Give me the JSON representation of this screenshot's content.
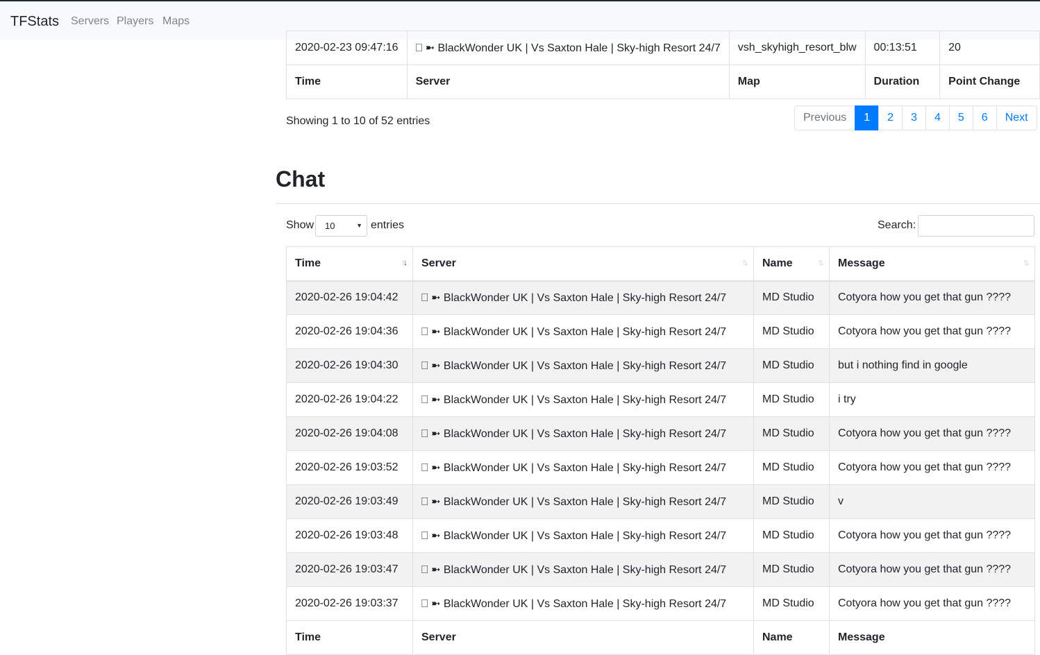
{
  "nav": {
    "brand": "TFStats",
    "links": [
      "Servers",
      "Players",
      "Maps"
    ]
  },
  "history": {
    "last_row": {
      "time": "2020-02-23 09:47:16",
      "server": "⎕ ➼ BlackWonder UK | Vs Saxton Hale | Sky-high Resort 24/7",
      "map": "vsh_skyhigh_resort_blw",
      "duration": "00:13:51",
      "points": "20"
    },
    "footer": [
      "Time",
      "Server",
      "Map",
      "Duration",
      "Point Change"
    ],
    "info": "Showing 1 to 10 of 52 entries",
    "pagination": {
      "previous": "Previous",
      "pages": [
        "1",
        "2",
        "3",
        "4",
        "5",
        "6"
      ],
      "next": "Next",
      "active": "1"
    }
  },
  "chat": {
    "title": "Chat",
    "length": {
      "show": "Show",
      "value": "10",
      "entries": "entries"
    },
    "search_label": "Search:",
    "headers": [
      "Time",
      "Server",
      "Name",
      "Message"
    ],
    "rows": [
      {
        "time": "2020-02-26 19:04:42",
        "server": "⎕ ➼ BlackWonder UK | Vs Saxton Hale | Sky-high Resort 24/7",
        "name": "MD Studio",
        "message": "Cotyora how you get that gun ????"
      },
      {
        "time": "2020-02-26 19:04:36",
        "server": "⎕ ➼ BlackWonder UK | Vs Saxton Hale | Sky-high Resort 24/7",
        "name": "MD Studio",
        "message": "Cotyora how you get that gun ????"
      },
      {
        "time": "2020-02-26 19:04:30",
        "server": "⎕ ➼ BlackWonder UK | Vs Saxton Hale | Sky-high Resort 24/7",
        "name": "MD Studio",
        "message": "but i nothing find in google"
      },
      {
        "time": "2020-02-26 19:04:22",
        "server": "⎕ ➼ BlackWonder UK | Vs Saxton Hale | Sky-high Resort 24/7",
        "name": "MD Studio",
        "message": "i try"
      },
      {
        "time": "2020-02-26 19:04:08",
        "server": "⎕ ➼ BlackWonder UK | Vs Saxton Hale | Sky-high Resort 24/7",
        "name": "MD Studio",
        "message": "Cotyora how you get that gun ????"
      },
      {
        "time": "2020-02-26 19:03:52",
        "server": "⎕ ➼ BlackWonder UK | Vs Saxton Hale | Sky-high Resort 24/7",
        "name": "MD Studio",
        "message": "Cotyora how you get that gun ????"
      },
      {
        "time": "2020-02-26 19:03:49",
        "server": "⎕ ➼ BlackWonder UK | Vs Saxton Hale | Sky-high Resort 24/7",
        "name": "MD Studio",
        "message": "v"
      },
      {
        "time": "2020-02-26 19:03:48",
        "server": "⎕ ➼ BlackWonder UK | Vs Saxton Hale | Sky-high Resort 24/7",
        "name": "MD Studio",
        "message": "Cotyora how you get that gun ????"
      },
      {
        "time": "2020-02-26 19:03:47",
        "server": "⎕ ➼ BlackWonder UK | Vs Saxton Hale | Sky-high Resort 24/7",
        "name": "MD Studio",
        "message": "Cotyora how you get that gun ????"
      },
      {
        "time": "2020-02-26 19:03:37",
        "server": "⎕ ➼ BlackWonder UK | Vs Saxton Hale | Sky-high Resort 24/7",
        "name": "MD Studio",
        "message": "Cotyora how you get that gun ????"
      }
    ],
    "footer": [
      "Time",
      "Server",
      "Name",
      "Message"
    ],
    "sort_icon": "sort-arrows-icon"
  },
  "colors": {
    "accent": "#007bff",
    "navbar": "#f8f9fa",
    "stripe": "#f2f2f2",
    "border": "#dee2e6"
  }
}
